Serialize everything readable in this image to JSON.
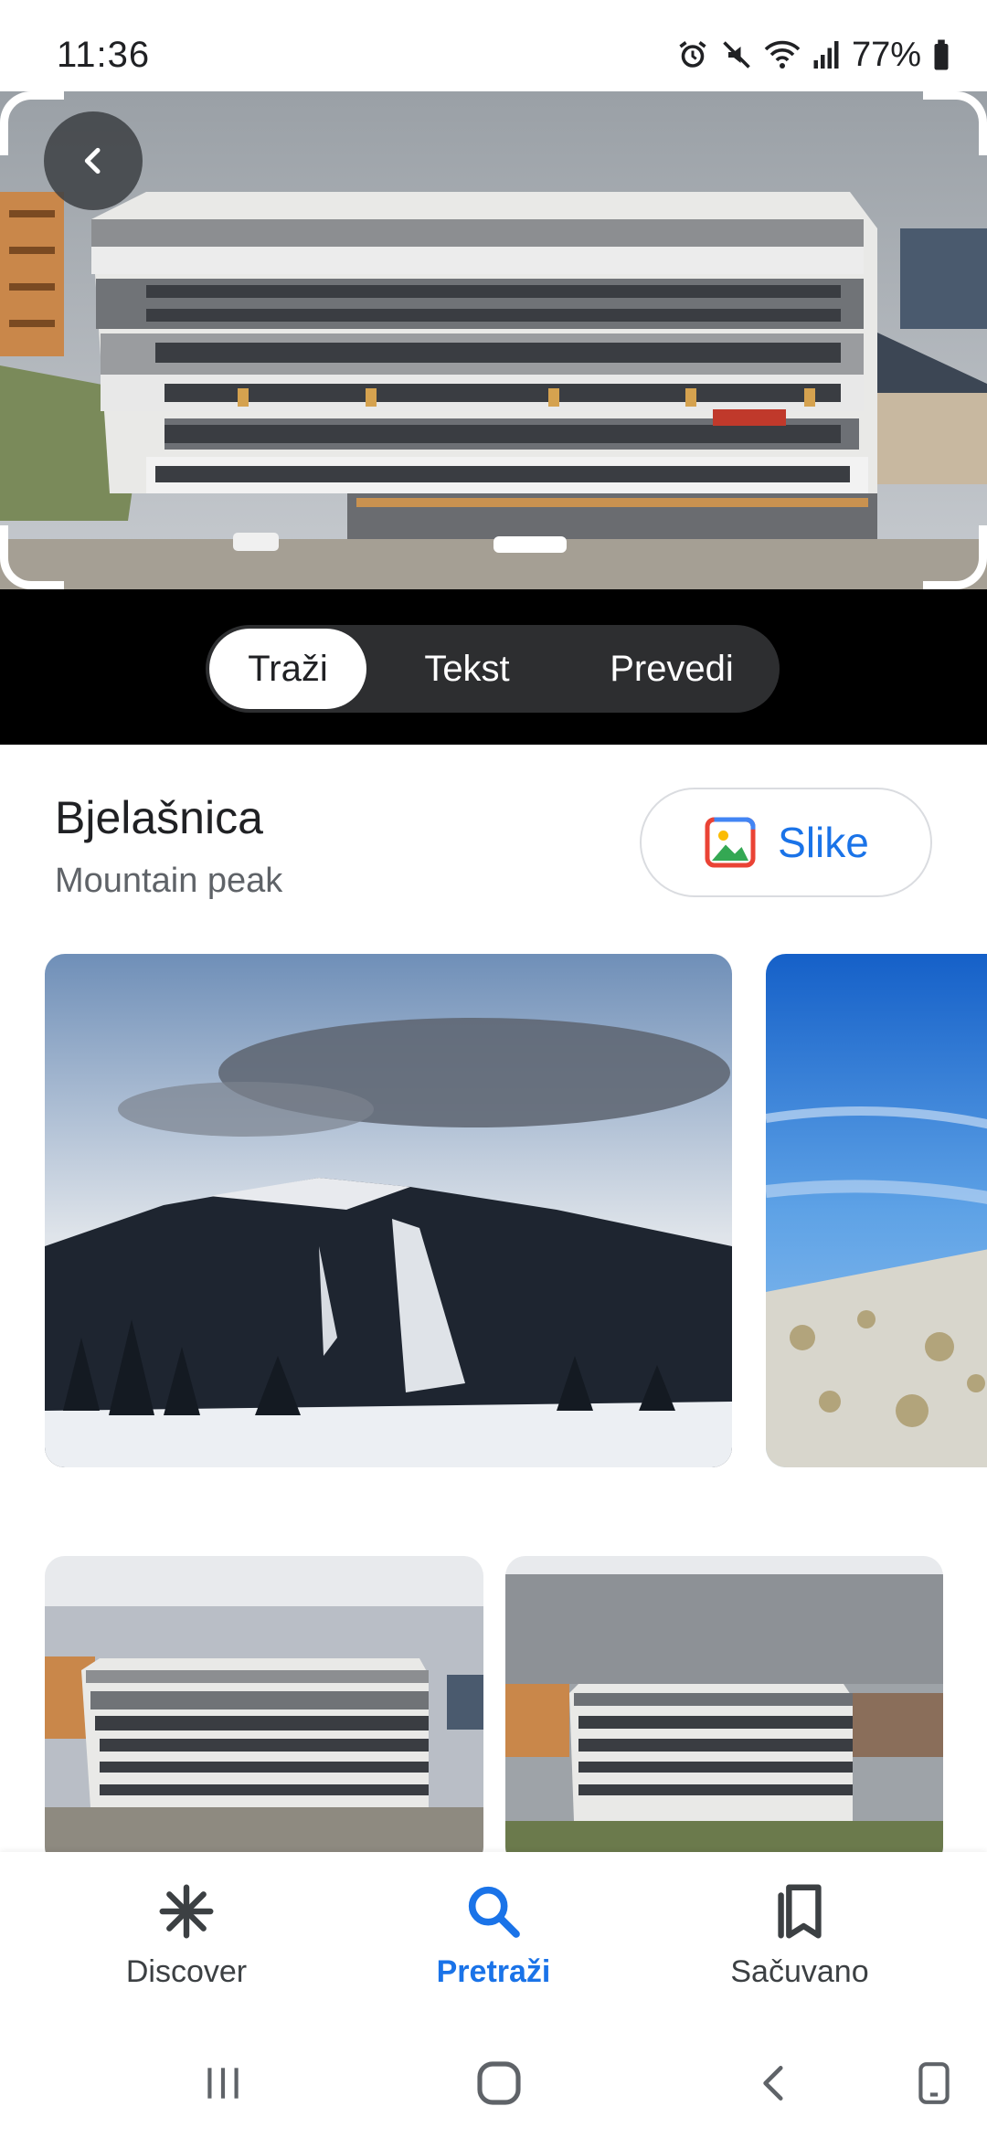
{
  "status_bar": {
    "time": "11:36",
    "battery": "77%",
    "icons": [
      "alarm-icon",
      "mute-icon",
      "wifi-icon",
      "signal-icon",
      "battery-icon"
    ]
  },
  "lens": {
    "modes": [
      {
        "label": "Traži",
        "active": true
      },
      {
        "label": "Tekst",
        "active": false
      },
      {
        "label": "Prevedi",
        "active": false
      }
    ]
  },
  "result": {
    "title": "Bjelašnica",
    "subtitle": "Mountain peak",
    "images_button": "Slike"
  },
  "bottom_nav": {
    "items": [
      {
        "label": "Discover",
        "icon": "discover-asterisk-icon",
        "active": false
      },
      {
        "label": "Pretraži",
        "icon": "search-icon",
        "active": true
      },
      {
        "label": "Sačuvano",
        "icon": "bookmarks-icon",
        "active": false
      }
    ]
  },
  "system_nav": [
    "recent-apps-icon",
    "home-icon",
    "back-icon",
    "rotate-icon"
  ],
  "colors": {
    "accent": "#1a73e8",
    "switch_bg": "#2d2e30",
    "viewer_bg": "#000000"
  }
}
